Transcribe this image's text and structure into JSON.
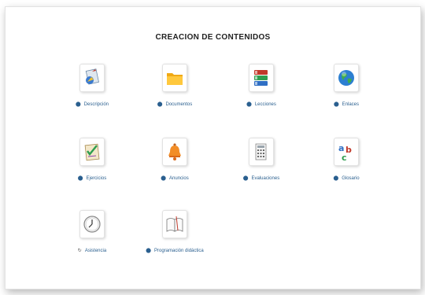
{
  "page": {
    "title": "CREACIÓN DE CONTENIDOS"
  },
  "tools": [
    {
      "label": "Descripción",
      "icon": "description-icon"
    },
    {
      "label": "Documentos",
      "icon": "folder-icon"
    },
    {
      "label": "Lecciones",
      "icon": "books-icon"
    },
    {
      "label": "Enlaces",
      "icon": "globe-icon"
    },
    {
      "label": "Ejercicios",
      "icon": "checklist-icon"
    },
    {
      "label": "Anuncios",
      "icon": "bell-icon"
    },
    {
      "label": "Evaluaciones",
      "icon": "calculator-icon"
    },
    {
      "label": "Glosario",
      "icon": "abc-icon"
    },
    {
      "label": "Asistencia",
      "icon": "clock-icon"
    },
    {
      "label": "Programación didáctica",
      "icon": "book-icon"
    }
  ]
}
